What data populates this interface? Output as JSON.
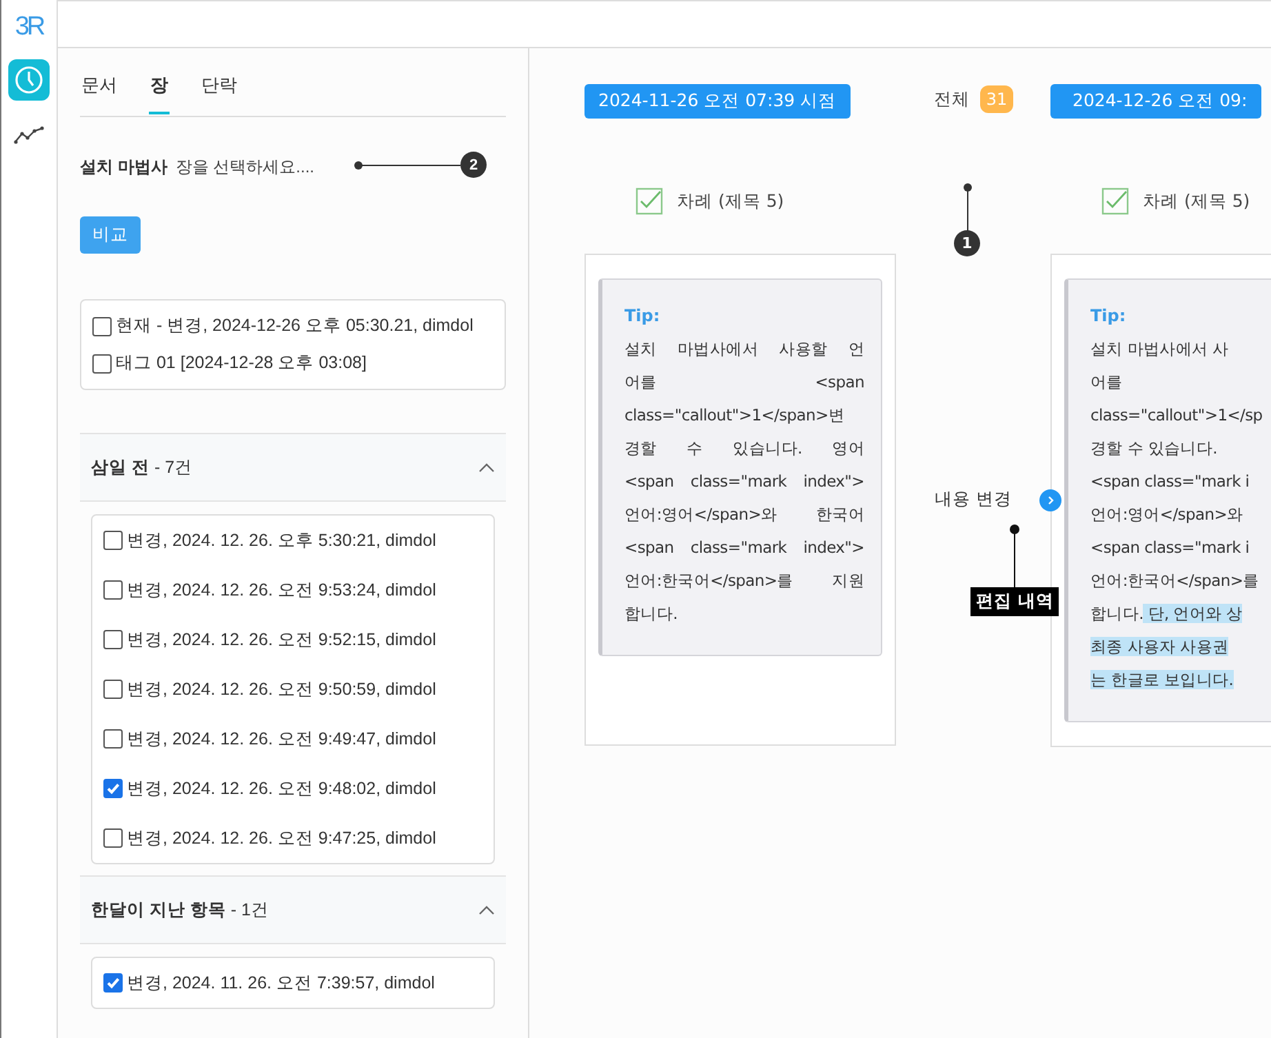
{
  "app": {
    "logo": "3R"
  },
  "rail": [
    {
      "kind": "clock",
      "selected": true
    },
    {
      "kind": "chart",
      "selected": false
    }
  ],
  "panel": {
    "tabs": [
      {
        "label": "문서",
        "selected": false
      },
      {
        "label": "장",
        "selected": true
      },
      {
        "label": "단락",
        "selected": false
      }
    ],
    "wizard": {
      "label": "설치 마법사",
      "value": "장을 선택하세요...."
    },
    "compare_button": "비교",
    "current_items": [
      {
        "label": "현재 - 변경, 2024-12-26 오후 05:30.21, dimdol",
        "checked": false
      },
      {
        "label": "태그 01 [2024-12-28 오후 03:08]",
        "checked": false
      }
    ],
    "groups": [
      {
        "title": "**삼일 전** - 7건",
        "expanded": true,
        "items": [
          {
            "label": "변경, 2024. 12. 26. 오후 5:30:21, dimdol",
            "checked": false
          },
          {
            "label": "변경, 2024. 12. 26. 오전 9:53:24, dimdol",
            "checked": false
          },
          {
            "label": "변경, 2024. 12. 26. 오전 9:52:15, dimdol",
            "checked": false
          },
          {
            "label": "변경, 2024. 12. 26. 오전 9:50:59, dimdol",
            "checked": false
          },
          {
            "label": "변경, 2024. 12. 26. 오전 9:49:47, dimdol",
            "checked": false
          },
          {
            "label": "변경, 2024. 12. 26. 오전 9:48:02, dimdol",
            "checked": true
          },
          {
            "label": "변경, 2024. 12. 26. 오전 9:47:25, dimdol",
            "checked": false
          }
        ]
      },
      {
        "title": "**한달이 지난 항목** - 1건",
        "expanded": true,
        "items": [
          {
            "label": "변경, 2024. 11. 26. 오전 7:39:57, dimdol",
            "checked": true
          }
        ]
      }
    ]
  },
  "main": {
    "total": {
      "label": "전체",
      "count": "31"
    },
    "change_label": "내용 변경",
    "versions": [
      {
        "date": "2024-11-26 오전 07:39 시점",
        "check_label": "차례 (제목 5)",
        "checked": true,
        "tip_title": "Tip:",
        "lines": [
          {
            "segments": [
              {
                "text": "설치 마법사에서 사용할 언",
                "highlighted": false
              }
            ]
          },
          {
            "segments": [
              {
                "text": "어를 <span",
                "highlighted": false
              }
            ]
          },
          {
            "segments": [
              {
                "text": "class=\"callout\">1</span>변",
                "highlighted": false
              }
            ]
          },
          {
            "segments": [
              {
                "text": "경할 수 있습니다. 영어",
                "highlighted": false
              }
            ]
          },
          {
            "segments": [
              {
                "text": "<span class=\"mark index\">",
                "highlighted": false
              }
            ]
          },
          {
            "segments": [
              {
                "text": "언어:영어</span>와 한국어",
                "highlighted": false
              }
            ]
          },
          {
            "segments": [
              {
                "text": "<span class=\"mark index\">",
                "highlighted": false
              }
            ]
          },
          {
            "segments": [
              {
                "text": "언어:한국어</span>를 지원",
                "highlighted": false
              }
            ]
          },
          {
            "segments": [
              {
                "text": "합니다.",
                "highlighted": false
              }
            ]
          }
        ]
      },
      {
        "date": "2024-12-26 오전 09:",
        "check_label": "차례 (제목 5)",
        "checked": true,
        "tip_title": "Tip:",
        "lines": [
          {
            "segments": [
              {
                "text": "설치 마법사에서 사",
                "highlighted": false
              }
            ]
          },
          {
            "segments": [
              {
                "text": "어를",
                "highlighted": false
              }
            ]
          },
          {
            "segments": [
              {
                "text": "class=\"callout\">1</sp",
                "highlighted": false
              }
            ]
          },
          {
            "segments": [
              {
                "text": "경할 수 있습니다.",
                "highlighted": false
              }
            ]
          },
          {
            "segments": [
              {
                "text": "<span class=\"mark i",
                "highlighted": false
              }
            ]
          },
          {
            "segments": [
              {
                "text": "언어:영어</span>와",
                "highlighted": false
              }
            ]
          },
          {
            "segments": [
              {
                "text": "<span class=\"mark i",
                "highlighted": false
              }
            ]
          },
          {
            "segments": [
              {
                "text": "언어:한국어</span>를",
                "highlighted": false
              }
            ]
          },
          {
            "segments": [
              {
                "text": "합니다.",
                "highlighted": false
              },
              {
                "text": " 단, 언어와 상",
                "highlighted": true
              }
            ]
          },
          {
            "segments": [
              {
                "text": "최종 사용자 사용권",
                "highlighted": true
              }
            ]
          },
          {
            "segments": [
              {
                "text": "는 한글로 보입니다.",
                "highlighted": true
              }
            ]
          }
        ]
      }
    ]
  },
  "annotations": {
    "markers": [
      "1",
      "2"
    ],
    "edit_history": "편집 내역"
  }
}
